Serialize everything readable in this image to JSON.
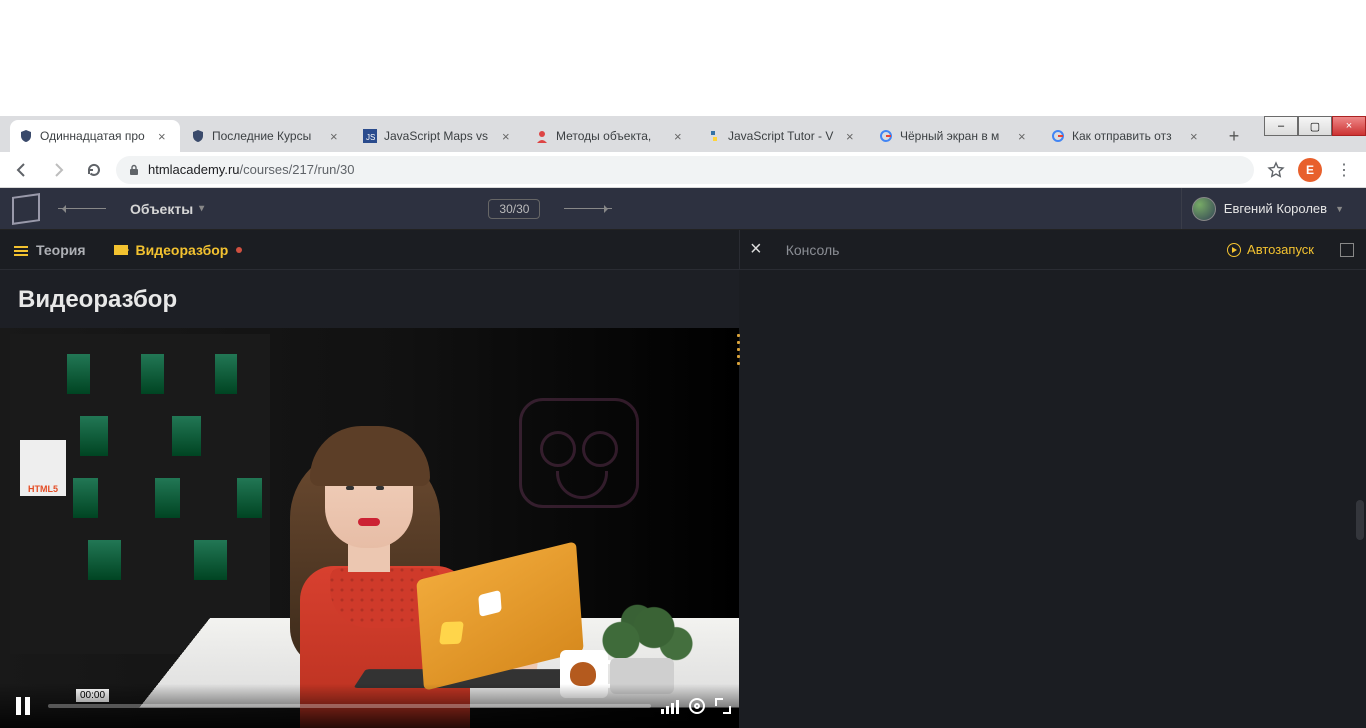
{
  "window_controls": {
    "minimize": "–",
    "maximize": "▢",
    "close": "×"
  },
  "tabs": [
    {
      "title": "Одиннадцатая про",
      "favicon": "shield"
    },
    {
      "title": "Последние Курсы",
      "favicon": "shield"
    },
    {
      "title": "JavaScript Maps vs",
      "favicon": "js"
    },
    {
      "title": "Методы объекта,",
      "favicon": "person"
    },
    {
      "title": "JavaScript Tutor - V",
      "favicon": "python"
    },
    {
      "title": "Чёрный экран в м",
      "favicon": "google"
    },
    {
      "title": "Как отправить отз",
      "favicon": "google"
    }
  ],
  "newtab": "+",
  "nav": {
    "back": "←",
    "forward": "→",
    "reload": "⟳"
  },
  "omnibox": {
    "domain": "htmlacademy.ru",
    "path": "/courses/217/run/30"
  },
  "profile_initial": "E",
  "menu_glyph": "⋮",
  "course": {
    "name": "Объекты",
    "progress": "30/30",
    "user": "Евгений Королев"
  },
  "lesson_tabs": {
    "theory": "Теория",
    "video": "Видеоразбор"
  },
  "section_title": "Видеоразбор",
  "console": {
    "close": "×",
    "label": "Консоль",
    "autorun": "Автозапуск"
  },
  "video": {
    "time": "00:00",
    "html5_book": "HTML5"
  }
}
